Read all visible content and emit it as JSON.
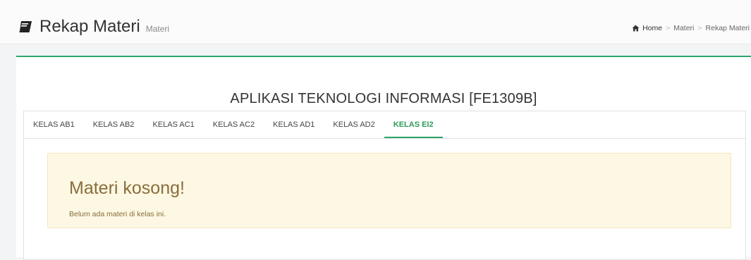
{
  "header": {
    "title": "Rekap Materi",
    "subtitle": "Materi",
    "title_icon": "book-icon"
  },
  "breadcrumb": {
    "home_icon": "home-icon",
    "items": [
      "Home",
      "Materi",
      "Rekap Materi"
    ],
    "separator": ">"
  },
  "course": {
    "title": "APLIKASI TEKNOLOGI INFORMASI [FE1309B]"
  },
  "tabs": [
    {
      "label": "KELAS AB1",
      "active": false
    },
    {
      "label": "KELAS AB2",
      "active": false
    },
    {
      "label": "KELAS AC1",
      "active": false
    },
    {
      "label": "KELAS AC2",
      "active": false
    },
    {
      "label": "KELAS AD1",
      "active": false
    },
    {
      "label": "KELAS AD2",
      "active": false
    },
    {
      "label": "KELAS EI2",
      "active": true
    }
  ],
  "alert": {
    "title": "Materi kosong!",
    "text": "Belum ada materi di kelas ini."
  },
  "colors": {
    "accent": "#2ea56b",
    "alert_bg": "#fcf8e3",
    "alert_text": "#8a6d3b"
  }
}
